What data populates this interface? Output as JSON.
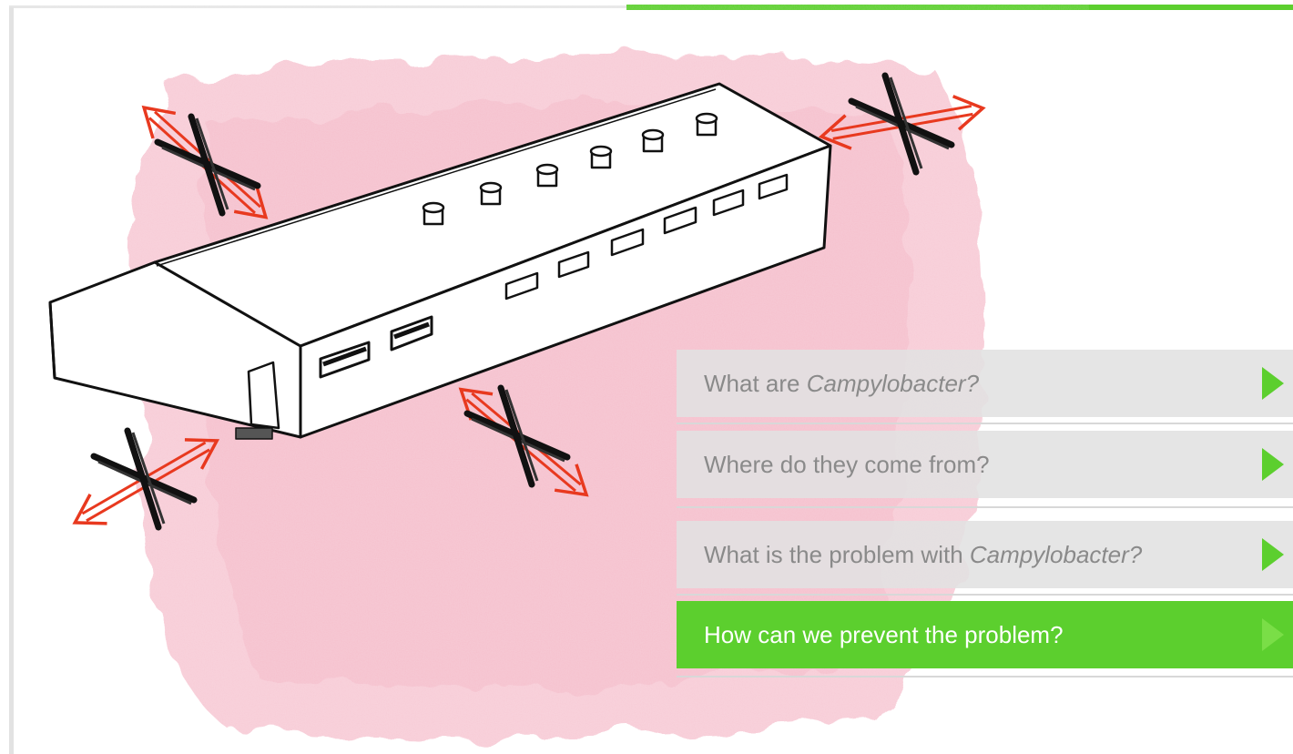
{
  "illustration": {
    "label": "",
    "icons": [
      "poultry-house",
      "blocked-airflow-cross",
      "double-arrow"
    ]
  },
  "colors": {
    "accent": "#5ccf2e",
    "wash": "#f7c6d2",
    "arrow": "#e8391f",
    "menu_inactive_bg": "#e1e1e1",
    "menu_inactive_text": "#8a8a8a"
  },
  "menu": {
    "items": [
      {
        "text": "What are ",
        "italic": "Campylobacter?",
        "active": false
      },
      {
        "text": "Where do they come from?",
        "italic": "",
        "active": false
      },
      {
        "text": "What is the problem with ",
        "italic": "Campylobacter?",
        "active": false
      },
      {
        "text": "How can we prevent the problem?",
        "italic": "",
        "active": true
      }
    ]
  }
}
